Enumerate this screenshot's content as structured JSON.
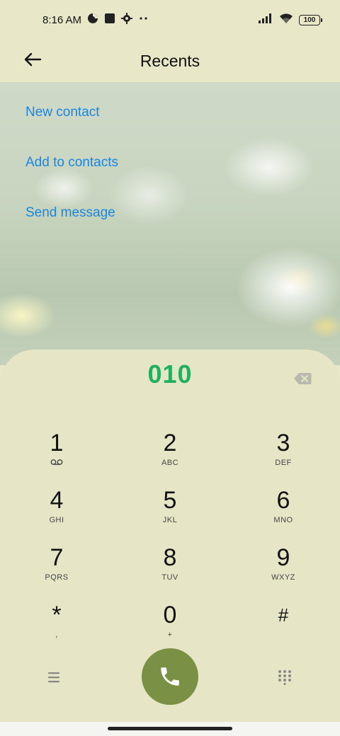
{
  "status_bar": {
    "time": "8:16 AM",
    "battery": "100",
    "icons": [
      "data-saver-icon",
      "notification-square-icon",
      "settings-gear-icon",
      "more-dots-icon",
      "signal-icon",
      "wifi-icon",
      "battery-icon"
    ]
  },
  "header": {
    "title": "Recents",
    "back_icon": "arrow-left-icon"
  },
  "menu": [
    {
      "label": "New contact"
    },
    {
      "label": "Add to contacts"
    },
    {
      "label": "Send message"
    }
  ],
  "dialer": {
    "number": "010",
    "backspace_icon": "backspace-icon",
    "keys": [
      {
        "digit": "1",
        "sub": "",
        "sub_icon": "voicemail-icon"
      },
      {
        "digit": "2",
        "sub": "ABC"
      },
      {
        "digit": "3",
        "sub": "DEF"
      },
      {
        "digit": "4",
        "sub": "GHI"
      },
      {
        "digit": "5",
        "sub": "JKL"
      },
      {
        "digit": "6",
        "sub": "MNO"
      },
      {
        "digit": "7",
        "sub": "PQRS"
      },
      {
        "digit": "8",
        "sub": "TUV"
      },
      {
        "digit": "9",
        "sub": "WXYZ"
      },
      {
        "digit": "*",
        "sub": ","
      },
      {
        "digit": "0",
        "sub": "+"
      },
      {
        "digit": "#",
        "sub": ""
      }
    ],
    "bottom": {
      "menu_icon": "hamburger-menu-icon",
      "call_icon": "phone-icon",
      "dialpad_icon": "dialpad-grid-icon"
    }
  },
  "colors": {
    "accent_link": "#1a86e0",
    "number_green": "#20b060",
    "call_button": "#7a9044",
    "panel_bg": "#e6e6c6"
  }
}
